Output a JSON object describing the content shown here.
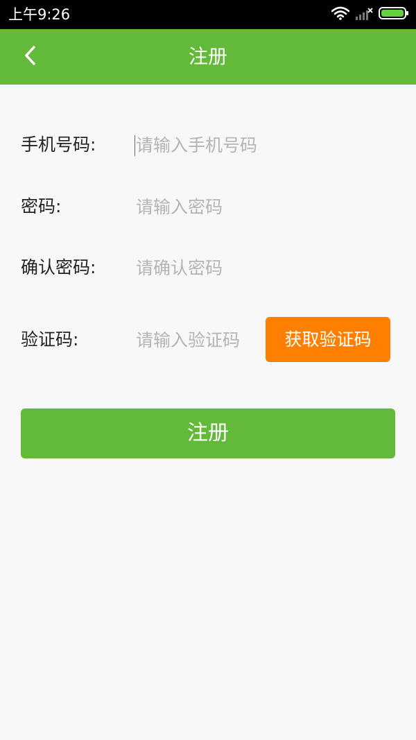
{
  "status_bar": {
    "time": "上午9:26",
    "icons": [
      "wifi-icon",
      "signal-icon",
      "battery-icon"
    ]
  },
  "app_bar": {
    "title": "注册",
    "back_icon": "chevron-left-icon"
  },
  "form": {
    "phone": {
      "label": "手机号码:",
      "placeholder": "请输入手机号码",
      "value": ""
    },
    "password": {
      "label": "密码:",
      "placeholder": "请输入密码",
      "value": ""
    },
    "confirm": {
      "label": "确认密码:",
      "placeholder": "请确认密码",
      "value": ""
    },
    "code": {
      "label": "验证码:",
      "placeholder": "请输入验证码",
      "value": "",
      "button_label": "获取验证码"
    }
  },
  "register_button_label": "注册",
  "colors": {
    "primary": "#62b93a",
    "accent": "#ff7f00",
    "background": "#f8f8f8",
    "placeholder": "#b4b4b4"
  }
}
